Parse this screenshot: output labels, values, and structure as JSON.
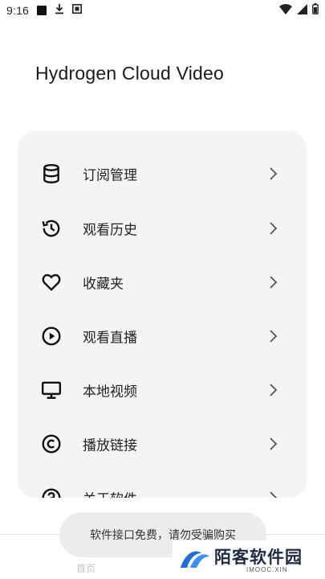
{
  "status_bar": {
    "time": "9:16",
    "icons": [
      "square-notification-icon",
      "download-icon",
      "app-notification-icon",
      "wifi-icon",
      "cell-signal-icon",
      "battery-icon"
    ]
  },
  "app": {
    "title": "Hydrogen Cloud Video"
  },
  "menu": {
    "items": [
      {
        "label": "订阅管理",
        "icon": "database-icon"
      },
      {
        "label": "观看历史",
        "icon": "history-icon"
      },
      {
        "label": "收藏夹",
        "icon": "heart-icon"
      },
      {
        "label": "观看直播",
        "icon": "play-circle-icon"
      },
      {
        "label": "本地视频",
        "icon": "monitor-icon"
      },
      {
        "label": "播放链接",
        "icon": "copyright-icon"
      },
      {
        "label": "关于软件",
        "icon": "help-icon"
      }
    ]
  },
  "bottom_nav": {
    "home_label": "首页"
  },
  "toast": {
    "text": "软件接口免费，请勿受骗购买"
  },
  "watermark": {
    "name": "陌客软件园",
    "domain": "IMOOC.XIN"
  },
  "colors": {
    "text": "#222222",
    "card": "#f4f4f4",
    "toast": "#ececec",
    "watermark": "#1f6fd6"
  }
}
